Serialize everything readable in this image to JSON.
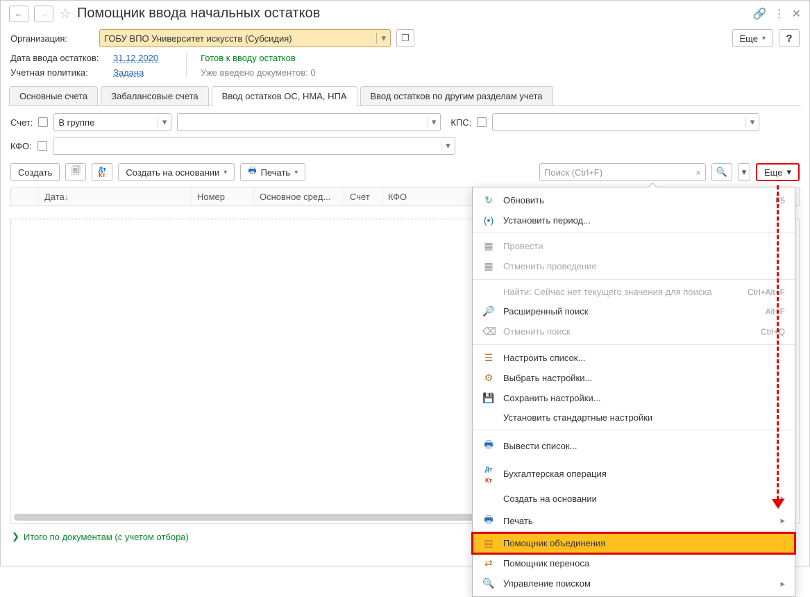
{
  "title": "Помощник ввода начальных остатков",
  "header_buttons": {
    "more": "Еще",
    "help": "?"
  },
  "org": {
    "label": "Организация:",
    "value": "ГОБУ ВПО Университет искусств (Субсидия)"
  },
  "date_row": {
    "label": "Дата ввода остатков:",
    "value": "31.12.2020",
    "status": "Готов к вводу остатков"
  },
  "policy_row": {
    "label": "Учетная политика:",
    "value": "Задана",
    "docs": "Уже введено документов:  0"
  },
  "tabs": [
    {
      "label": "Основные счета"
    },
    {
      "label": "Забалансовые счета"
    },
    {
      "label": "Ввод остатков ОС, НМА, НПА"
    },
    {
      "label": "Ввод остатков по другим разделам учета"
    }
  ],
  "filters": {
    "schet": "Счет:",
    "group": "В группе",
    "kps": "КПС:",
    "kfo": "КФО:"
  },
  "toolbar": {
    "create": "Создать",
    "create_based": "Создать на основании",
    "print": "Печать",
    "search_placeholder": "Поиск (Ctrl+F)",
    "more": "Еще"
  },
  "grid": {
    "cols": [
      "",
      "Дата",
      "Номер",
      "Основное сред...",
      "Счет",
      "КФО"
    ]
  },
  "footer": "Итого по документам (с учетом отбора)",
  "menu": {
    "items": [
      {
        "icon": "↻",
        "iconcls": "",
        "text": "Обновить",
        "hot": "F5"
      },
      {
        "icon": "(•)",
        "iconcls": "blue",
        "text": "Установить период..."
      },
      {
        "sep": true
      },
      {
        "icon": "▦",
        "iconcls": "gray",
        "text": "Провести",
        "disabled": true
      },
      {
        "icon": "▦",
        "iconcls": "gray",
        "text": "Отменить проведение",
        "disabled": true
      },
      {
        "sep": true
      },
      {
        "icon": "",
        "text": "Найти: Сейчас нет текущего значения для поиска",
        "hot": "Ctrl+Alt+F",
        "disabled": true
      },
      {
        "icon": "🔎",
        "iconcls": "blue",
        "text": "Расширенный поиск",
        "hot": "Alt+F"
      },
      {
        "icon": "⌫",
        "iconcls": "gray",
        "text": "Отменить поиск",
        "hot": "Ctrl+Q",
        "disabled": true
      },
      {
        "sep": true
      },
      {
        "icon": "☰",
        "iconcls": "brown",
        "text": "Настроить список..."
      },
      {
        "icon": "⚙",
        "iconcls": "brown",
        "text": "Выбрать настройки..."
      },
      {
        "icon": "💾",
        "iconcls": "brown",
        "text": "Сохранить настройки..."
      },
      {
        "icon": "",
        "text": "Установить стандартные настройки"
      },
      {
        "sep": true
      },
      {
        "icon": "🖶",
        "iconcls": "blue",
        "text": "Вывести список..."
      },
      {
        "icon": "DK",
        "iconcls": "",
        "text": "Бухгалтерская операция",
        "dtkt": true
      },
      {
        "icon": "",
        "text": "Создать на основании",
        "sub": true
      },
      {
        "icon": "🖶",
        "iconcls": "blue",
        "text": "Печать",
        "sub": true
      },
      {
        "icon": "▤",
        "iconcls": "brown",
        "text": "Помощник объединения",
        "highlight": true
      },
      {
        "icon": "⇄",
        "iconcls": "brown",
        "text": "Помощник переноса"
      },
      {
        "icon": "🔍",
        "iconcls": "blue",
        "text": "Управление поиском",
        "sub": true
      }
    ]
  }
}
